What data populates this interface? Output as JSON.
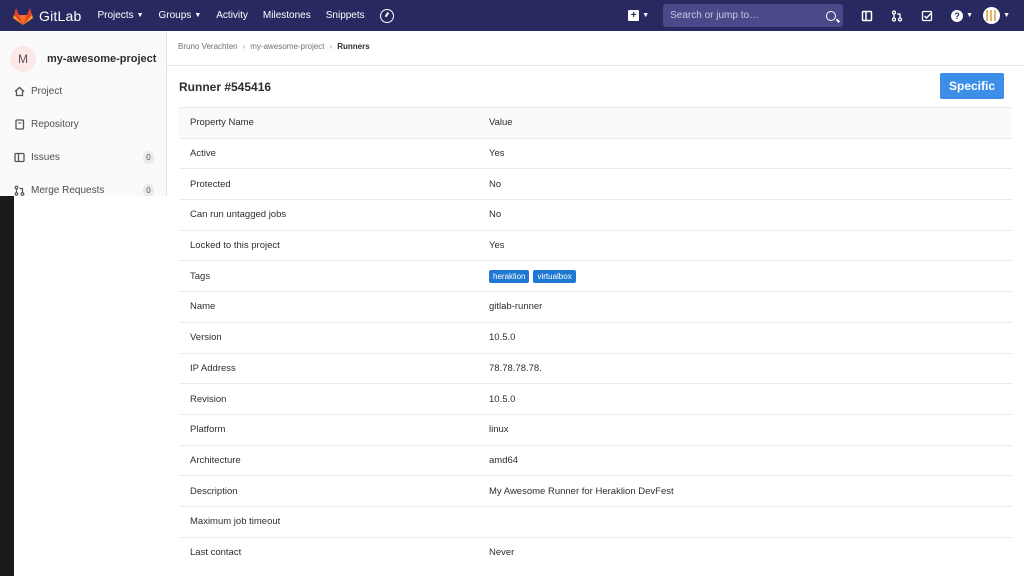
{
  "navbar": {
    "brand": "GitLab",
    "links": [
      "Projects",
      "Groups",
      "Activity",
      "Milestones",
      "Snippets"
    ],
    "search_placeholder": "Search or jump to…"
  },
  "sidebar": {
    "avatar_letter": "M",
    "project_name": "my-awesome-project",
    "items": [
      {
        "label": "Project"
      },
      {
        "label": "Repository"
      },
      {
        "label": "Issues",
        "count": "0"
      },
      {
        "label": "Merge Requests",
        "count": "0"
      }
    ]
  },
  "breadcrumb": {
    "user": "Bruno Verachten",
    "project": "my-awesome-project",
    "current": "Runners"
  },
  "page": {
    "title": "Runner #545416",
    "badge": "Specific"
  },
  "table": {
    "header": {
      "key": "Property Name",
      "value": "Value"
    },
    "rows": [
      {
        "key": "Active",
        "value": "Yes"
      },
      {
        "key": "Protected",
        "value": "No"
      },
      {
        "key": "Can run untagged jobs",
        "value": "No"
      },
      {
        "key": "Locked to this project",
        "value": "Yes"
      },
      {
        "key": "Tags",
        "tags": [
          "heraklion",
          "virtualbox"
        ]
      },
      {
        "key": "Name",
        "value": "gitlab-runner"
      },
      {
        "key": "Version",
        "value": "10.5.0"
      },
      {
        "key": "IP Address",
        "value": "78.78.78.78."
      },
      {
        "key": "Revision",
        "value": "10.5.0"
      },
      {
        "key": "Platform",
        "value": "linux"
      },
      {
        "key": "Architecture",
        "value": "amd64"
      },
      {
        "key": "Description",
        "value": "My Awesome Runner for Heraklion DevFest"
      },
      {
        "key": "Maximum job timeout",
        "value": ""
      },
      {
        "key": "Last contact",
        "value": "Never"
      }
    ]
  }
}
